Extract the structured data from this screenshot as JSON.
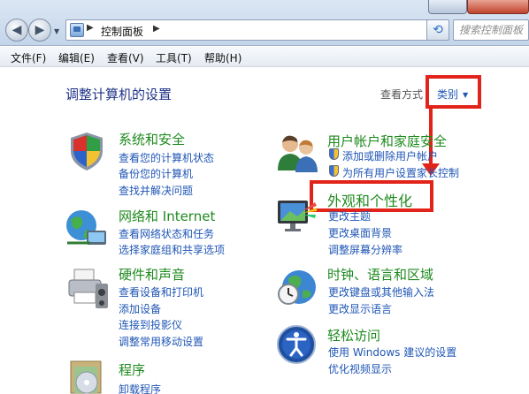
{
  "address": {
    "crumb": "控制面板"
  },
  "search": {
    "placeholder": "搜索控制面板"
  },
  "menu": {
    "file": "文件(F)",
    "edit": "编辑(E)",
    "view": "查看(V)",
    "tools": "工具(T)",
    "help": "帮助(H)"
  },
  "page": {
    "heading": "调整计算机的设置",
    "view_by_label": "查看方式",
    "view_by_value": "类别"
  },
  "categories": {
    "system": {
      "title": "系统和安全",
      "links": [
        "查看您的计算机状态",
        "备份您的计算机",
        "查找并解决问题"
      ]
    },
    "network": {
      "title": "网络和 Internet",
      "links": [
        "查看网络状态和任务",
        "选择家庭组和共享选项"
      ]
    },
    "hardware": {
      "title": "硬件和声音",
      "links": [
        "查看设备和打印机",
        "添加设备",
        "连接到投影仪",
        "调整常用移动设置"
      ]
    },
    "programs": {
      "title": "程序",
      "links": [
        "卸载程序"
      ]
    },
    "users": {
      "title": "用户帐户和家庭安全",
      "links": [
        "添加或删除用户帐户",
        "为所有用户设置家长控制"
      ]
    },
    "appearance": {
      "title": "外观和个性化",
      "links": [
        "更改主题",
        "更改桌面背景",
        "调整屏幕分辨率"
      ]
    },
    "clock": {
      "title": "时钟、语言和区域",
      "links": [
        "更改键盘或其他输入法",
        "更改显示语言"
      ]
    },
    "ease": {
      "title": "轻松访问",
      "links": [
        "使用 Windows 建议的设置",
        "优化视频显示"
      ]
    }
  },
  "colors": {
    "highlight": "#e2231a",
    "link": "#1f56b5",
    "category_title": "#1e8a1e",
    "heading": "#1e3287"
  }
}
